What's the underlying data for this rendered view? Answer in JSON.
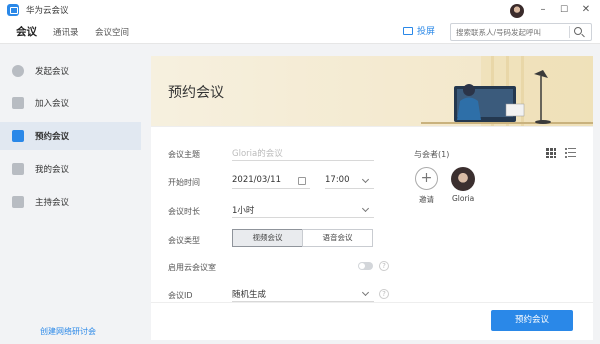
{
  "app": {
    "title": "华为云会议"
  },
  "window": {
    "minimize": "–",
    "restore": "☐",
    "close": "✕"
  },
  "nav": {
    "tabs": [
      "会议",
      "通讯录",
      "会议空间"
    ],
    "present_label": "投屏",
    "search_placeholder": "搜索联系人/号码发起呼叫"
  },
  "sidebar": {
    "items": [
      {
        "label": "发起会议",
        "icon": "chat-bubble-icon"
      },
      {
        "label": "加入会议",
        "icon": "enter-icon"
      },
      {
        "label": "预约会议",
        "icon": "calendar-icon"
      },
      {
        "label": "我的会议",
        "icon": "meeting-list-icon"
      },
      {
        "label": "主持会议",
        "icon": "host-icon"
      }
    ],
    "active": "预约会议",
    "webinar_link": "创建网络研讨会"
  },
  "card": {
    "title": "预约会议",
    "form": {
      "subject": {
        "label": "会议主题",
        "placeholder": "Gloria的会议"
      },
      "start": {
        "label": "开始时间",
        "date": "2021/03/11",
        "time": "17:00"
      },
      "duration": {
        "label": "会议时长",
        "value": "1小时"
      },
      "type": {
        "label": "会议类型",
        "options": [
          "视频会议",
          "语音会议"
        ],
        "selected": "视频会议"
      },
      "cloud_room": {
        "label": "启用云会议室",
        "enabled": false
      },
      "meeting_id": {
        "label": "会议ID",
        "value": "随机生成"
      }
    },
    "participants": {
      "title": "与会者(1)",
      "invite_label": "邀请",
      "people": [
        {
          "name": "Gloria"
        }
      ]
    },
    "submit_label": "预约会议"
  },
  "colors": {
    "accent": "#2a88e8",
    "banner": "#f4ead0"
  }
}
